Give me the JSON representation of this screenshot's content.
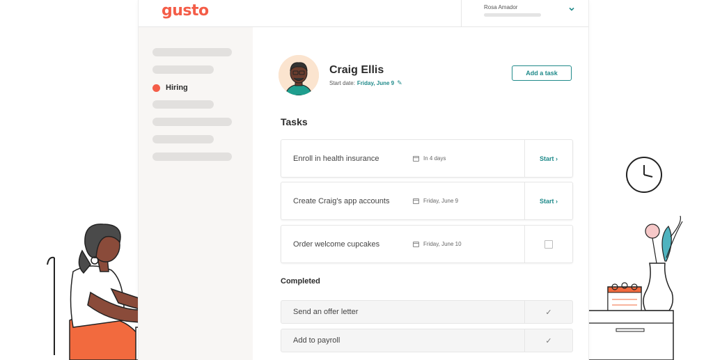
{
  "header": {
    "logo": "gusto",
    "account_name": "Rosa Amador"
  },
  "sidebar": {
    "active_label": "Hiring"
  },
  "employee": {
    "name": "Craig Ellis",
    "start_label": "Start date:",
    "start_date": "Friday, June 9"
  },
  "actions": {
    "add_task": "Add a task"
  },
  "tasks_title": "Tasks",
  "tasks": [
    {
      "name": "Enroll in health insurance",
      "due": "In 4 days",
      "action": "Start ›"
    },
    {
      "name": "Create Craig's app accounts",
      "due": "Friday, June 9",
      "action": "Start ›"
    },
    {
      "name": "Order welcome cupcakes",
      "due": "Friday, June 10",
      "action": ""
    }
  ],
  "completed_title": "Completed",
  "completed": [
    {
      "name": "Send an offer letter"
    },
    {
      "name": "Add to payroll"
    }
  ],
  "icons": {
    "chevron": "chevron-down-icon",
    "calendar": "calendar-icon",
    "pencil": "pencil-icon",
    "check": "checkmark-icon"
  },
  "colors": {
    "brand": "#f45d48",
    "accent": "#1f8a8a",
    "sidebar_bg": "#f8f6f4"
  }
}
